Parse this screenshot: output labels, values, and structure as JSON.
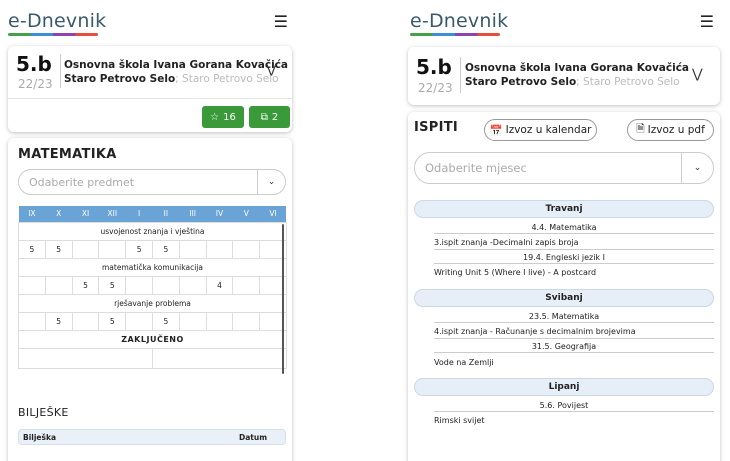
{
  "app": {
    "logo": "e-Dnevnik",
    "menu_icon": "hamburger-menu-icon"
  },
  "class_card": {
    "class_name": "5.b",
    "school_year": "22/23",
    "school_name": "Osnovna škola Ivana Gorana Kovačića",
    "place_bold": "Staro Petrovo Selo",
    "place_light": "; Staro Petrovo Selo",
    "expand_icon": "double-chevron-down-icon"
  },
  "left": {
    "stars_count": "16",
    "copies_count": "2",
    "subject_title": "MATEMATIKA",
    "subject_select_placeholder": "Odaberite predmet",
    "months": [
      "IX",
      "X",
      "XI",
      "XII",
      "I",
      "II",
      "III",
      "IV",
      "V",
      "VI"
    ],
    "categories": [
      {
        "label": "usvojenost znanja i vještina",
        "grades": [
          "5",
          "5",
          "",
          "",
          "5",
          "5",
          "",
          "",
          "",
          ""
        ]
      },
      {
        "label": "matematička komunikacija",
        "grades": [
          "",
          "",
          "5",
          "5",
          "",
          "",
          "",
          "4",
          "",
          ""
        ]
      },
      {
        "label": "rješavanje problema",
        "grades": [
          "",
          "5",
          "",
          "5",
          "",
          "5",
          "",
          "",
          "",
          ""
        ]
      }
    ],
    "final_label": "ZAKLJUČENO",
    "notes_title": "BILJEŠKE",
    "notes_col_note": "Bilješka",
    "notes_col_date": "Datum"
  },
  "right": {
    "title": "ISPITI",
    "export_calendar": "Izvoz u kalendar",
    "export_pdf": "Izvoz u pdf",
    "month_select_placeholder": "Odaberite mjesec",
    "months": [
      {
        "name": "Travanj",
        "exams": [
          {
            "date": "4.4. Matematika",
            "desc": "3.ispit znanja -Decimalni zapis broja"
          },
          {
            "date": "19.4. Engleski jezik I",
            "desc": "Writing Unit 5 (Where I live) - A postcard"
          }
        ]
      },
      {
        "name": "Svibanj",
        "exams": [
          {
            "date": "23.5. Matematika",
            "desc": "4.ispit znanja - Računanje s decimalnim brojevima"
          },
          {
            "date": "31.5. Geografija",
            "desc": "Vode na Zemlji"
          }
        ]
      },
      {
        "name": "Lipanj",
        "exams": [
          {
            "date": "5.6. Povijest",
            "desc": "Rimski svijet"
          }
        ]
      }
    ]
  },
  "colors": {
    "accent_green": "#3a9a3a",
    "table_header_blue": "#6aa3d6",
    "pill_bg": "#e6eef7"
  }
}
